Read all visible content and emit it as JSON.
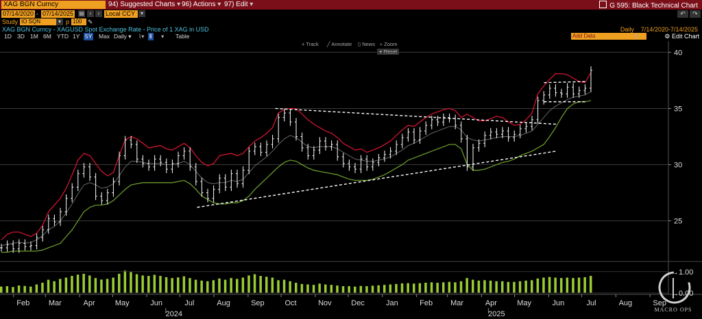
{
  "header": {
    "ticker": "XAG BGN Curncy",
    "menu": [
      {
        "num": "94)",
        "label": "Suggested Charts"
      },
      {
        "num": "96)",
        "label": "Actions"
      },
      {
        "num": "97)",
        "label": "Edit"
      }
    ],
    "title_right": "G 595: Black Technical Chart",
    "date_start": "07/14/2020",
    "date_end": "07/14/2025",
    "currency": "Local CCY",
    "study_label": "Study",
    "study_value": "IO SQN",
    "p_label": "p",
    "p_value": "100",
    "description": "XAG BGN Curncy - XAGUSD Spot Exchange Rate - Price of 1 XAG in USD",
    "frequency": "Daily",
    "date_range": "7/14/2020-7/14/2025",
    "range_buttons": [
      "1D",
      "3D",
      "1M",
      "6M",
      "YTD",
      "1Y",
      "5Y",
      "Max"
    ],
    "selected_range": "5Y",
    "freq_dropdown": "Daily",
    "table_label": "Table",
    "add_data": "Add Data",
    "edit_chart": "Edit Chart",
    "tools": [
      "Track",
      "Annotate",
      "News",
      "Zoom"
    ],
    "reset": "Reset",
    "watermark": "MACRO OPS",
    "colors": {
      "accent": "#f0a020",
      "header_bg": "#7a0f1a",
      "price": "#ffffff",
      "upper_band": "#d01530",
      "lower_band": "#6a9a2a",
      "volume": "#9acd32"
    }
  },
  "chart_data": {
    "type": "line",
    "title": "",
    "ylim": [
      21.5,
      41
    ],
    "yticks": [
      25,
      30,
      35,
      40
    ],
    "volume_ticks": [
      "1.00",
      "0.00"
    ],
    "x_months": [
      "Feb",
      "Mar",
      "Apr",
      "May",
      "Jun",
      "Jul",
      "Aug",
      "Sep",
      "Oct",
      "Nov",
      "Dec",
      "Jan",
      "Feb",
      "Mar",
      "Apr",
      "May",
      "Jun",
      "Jul",
      "Aug",
      "Sep"
    ],
    "years": [
      "2024",
      "2025"
    ],
    "series": [
      {
        "values": [
          22.6,
          22.9,
          22.5,
          23.0,
          22.7,
          22.8,
          23.5,
          24.2,
          25.2,
          24.9,
          25.8,
          27.0,
          28.0,
          29.2,
          29.8,
          28.9,
          27.2,
          26.8,
          27.5,
          28.5,
          30.8,
          32.2,
          31.8,
          30.5,
          30.1,
          29.8,
          30.5,
          30.2,
          29.6,
          30.1,
          30.8,
          31.2,
          29.8,
          28.5,
          27.5,
          27.0,
          27.8,
          28.8,
          28.0,
          29.2,
          28.3,
          29.5,
          31.2,
          31.6,
          31.1,
          31.8,
          32.3,
          34.2,
          34.6,
          33.8,
          32.5,
          31.5,
          30.8,
          31.3,
          32.1,
          31.6,
          31.8,
          30.7,
          30.1,
          29.8,
          29.6,
          30.5,
          29.8,
          30.2,
          30.6,
          30.9,
          31.2,
          31.8,
          32.4,
          32.9,
          32.2,
          33.0,
          33.5,
          34.0,
          33.8,
          34.2,
          34.1,
          33.5,
          32.3,
          29.8,
          31.5,
          31.9,
          32.6,
          32.9,
          32.7,
          33.0,
          32.4,
          32.7,
          33.2,
          33.4,
          34.0,
          35.7,
          36.2,
          36.8,
          36.4,
          36.3,
          36.9,
          36.3,
          36.6,
          36.8,
          38.4
        ]
      },
      {
        "values": [
          22.8,
          22.9,
          23.0,
          23.1,
          23.0,
          23.1,
          23.3,
          23.7,
          24.2,
          24.5,
          25.0,
          25.7,
          26.5,
          27.4,
          28.2,
          28.4,
          28.2,
          27.9,
          28.0,
          28.3,
          29.0,
          29.8,
          30.3,
          30.3,
          30.2,
          30.1,
          30.1,
          30.1,
          30.0,
          30.0,
          30.1,
          30.3,
          30.0,
          29.4,
          28.8,
          28.4,
          28.3,
          28.4,
          28.4,
          28.6,
          28.5,
          28.7,
          29.3,
          29.9,
          30.3,
          30.7,
          31.2,
          31.8,
          32.3,
          32.6,
          32.4,
          32.0,
          31.6,
          31.5,
          31.6,
          31.6,
          31.6,
          31.4,
          31.1,
          30.8,
          30.5,
          30.4,
          30.3,
          30.3,
          30.4,
          30.5,
          30.7,
          31.0,
          31.3,
          31.7,
          31.9,
          32.2,
          32.5,
          32.8,
          33.0,
          33.2,
          33.4,
          33.4,
          33.1,
          32.4,
          32.2,
          32.1,
          32.2,
          32.3,
          32.4,
          32.5,
          32.5,
          32.5,
          32.6,
          32.8,
          33.0,
          33.6,
          34.2,
          34.8,
          35.2,
          35.5,
          35.8,
          36.0,
          36.1,
          36.2,
          36.5
        ]
      },
      {
        "values": [
          23.3,
          23.8,
          24.0,
          24.0,
          23.8,
          23.6,
          23.9,
          24.6,
          25.8,
          26.4,
          27.0,
          27.9,
          29.1,
          30.4,
          31.0,
          30.8,
          30.1,
          29.4,
          29.0,
          29.3,
          30.8,
          32.2,
          32.5,
          32.3,
          31.9,
          31.5,
          31.6,
          31.7,
          31.4,
          31.3,
          31.6,
          31.9,
          31.5,
          30.8,
          30.2,
          29.9,
          30.1,
          30.8,
          30.9,
          31.0,
          30.8,
          31.0,
          31.6,
          32.1,
          32.4,
          32.8,
          33.3,
          34.6,
          34.9,
          35.0,
          35.0,
          34.5,
          34.0,
          33.6,
          33.3,
          33.0,
          32.8,
          32.4,
          31.9,
          31.6,
          31.3,
          31.4,
          31.1,
          31.3,
          31.5,
          31.8,
          32.1,
          32.6,
          33.1,
          33.5,
          33.4,
          33.8,
          34.2,
          34.5,
          34.7,
          34.9,
          35.0,
          34.8,
          34.2,
          34.5,
          34.2,
          33.9,
          33.9,
          34.1,
          34.3,
          34.2,
          33.8,
          33.5,
          33.6,
          34.0,
          34.6,
          36.3,
          37.0,
          37.6,
          38.1,
          38.1,
          38.0,
          37.7,
          37.4,
          37.3,
          38.2
        ]
      },
      {
        "values": [
          22.2,
          22.2,
          22.3,
          22.3,
          22.3,
          22.3,
          22.3,
          22.4,
          22.6,
          22.8,
          23.0,
          23.6,
          24.2,
          25.0,
          25.8,
          26.2,
          26.4,
          26.4,
          26.5,
          26.8,
          27.3,
          27.8,
          28.2,
          28.3,
          28.4,
          28.4,
          28.4,
          28.4,
          28.4,
          28.4,
          28.5,
          28.6,
          28.3,
          27.8,
          27.2,
          26.9,
          26.6,
          26.5,
          26.5,
          26.6,
          26.6,
          26.8,
          27.2,
          27.8,
          28.3,
          28.8,
          29.3,
          29.8,
          30.2,
          30.4,
          30.3,
          30.0,
          29.7,
          29.5,
          29.4,
          29.3,
          29.2,
          29.1,
          28.9,
          28.7,
          28.6,
          28.6,
          28.6,
          28.7,
          28.9,
          29.1,
          29.4,
          29.7,
          30.0,
          30.4,
          30.6,
          30.8,
          31.0,
          31.2,
          31.4,
          31.6,
          31.8,
          31.8,
          31.4,
          30.0,
          29.5,
          29.5,
          29.6,
          29.8,
          30.0,
          30.2,
          30.3,
          30.5,
          30.8,
          31.0,
          31.2,
          31.5,
          31.8,
          32.5,
          33.3,
          34.2,
          35.0,
          35.4,
          35.6,
          35.6,
          35.7
        ]
      }
    ],
    "trendlines": [
      {
        "x": [
          "2024-07-22",
          "2025-06-13"
        ],
        "y": [
          26.2,
          31.2
        ]
      },
      {
        "x": [
          "2024-10-01",
          "2025-06-13"
        ],
        "y": [
          35.0,
          33.6
        ]
      },
      {
        "x": [
          "2025-06-02",
          "2025-07-11"
        ],
        "y": [
          37.3,
          37.4
        ]
      },
      {
        "x": [
          "2025-06-02",
          "2025-07-11"
        ],
        "y": [
          35.6,
          35.6
        ]
      }
    ],
    "volume": {
      "values": [
        0.3,
        0.32,
        0.28,
        0.35,
        0.33,
        0.3,
        0.4,
        0.48,
        0.62,
        0.55,
        0.66,
        0.72,
        0.8,
        0.86,
        0.9,
        0.82,
        0.7,
        0.63,
        0.66,
        0.72,
        0.9,
        1.05,
        0.98,
        0.88,
        0.82,
        0.8,
        0.85,
        0.8,
        0.74,
        0.7,
        0.73,
        0.78,
        0.7,
        0.62,
        0.58,
        0.55,
        0.6,
        0.68,
        0.62,
        0.7,
        0.66,
        0.72,
        0.82,
        0.88,
        0.8,
        0.76,
        0.72,
        0.6,
        0.62,
        0.55,
        0.48,
        0.42,
        0.4,
        0.38,
        0.44,
        0.4,
        0.38,
        0.35,
        0.32,
        0.32,
        0.3,
        0.33,
        0.32,
        0.34,
        0.36,
        0.38,
        0.4,
        0.42,
        0.45,
        0.46,
        0.44,
        0.46,
        0.48,
        0.5,
        0.48,
        0.5,
        0.52,
        0.5,
        0.55,
        0.7,
        0.62,
        0.58,
        0.6,
        0.58,
        0.55,
        0.55,
        0.52,
        0.52,
        0.55,
        0.58,
        0.6,
        0.68,
        0.72,
        0.75,
        0.72,
        0.7,
        0.72,
        0.7,
        0.72,
        0.74,
        0.8
      ]
    }
  }
}
